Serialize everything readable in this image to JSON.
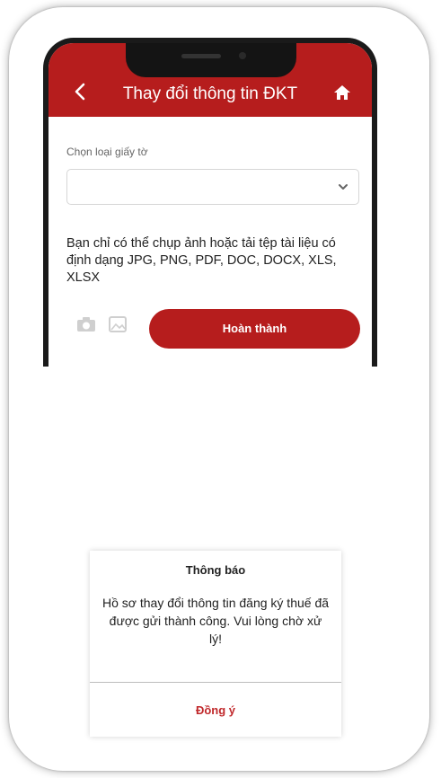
{
  "header": {
    "title": "Thay đổi thông tin ĐKT",
    "back_icon": "chevron-left-icon",
    "home_icon": "home-icon"
  },
  "form": {
    "document_type_label": "Chọn loại giấy tờ",
    "document_type_value": "",
    "note": "Bạn chỉ có thể chụp ảnh hoặc tải tệp tài liệu có định dạng JPG, PNG, PDF, DOC, DOCX, XLS, XLSX",
    "camera_icon": "camera-icon",
    "image_icon": "image-icon",
    "finish_label": "Hoàn thành"
  },
  "dialog": {
    "title": "Thông báo",
    "message": "Hồ sơ thay đổi thông tin đăng ký thuế đã được gửi thành công. Vui lòng chờ xử lý!",
    "confirm_label": "Đồng ý"
  },
  "colors": {
    "brand_red": "#b61d1d",
    "confirm_text": "#c0282b"
  }
}
